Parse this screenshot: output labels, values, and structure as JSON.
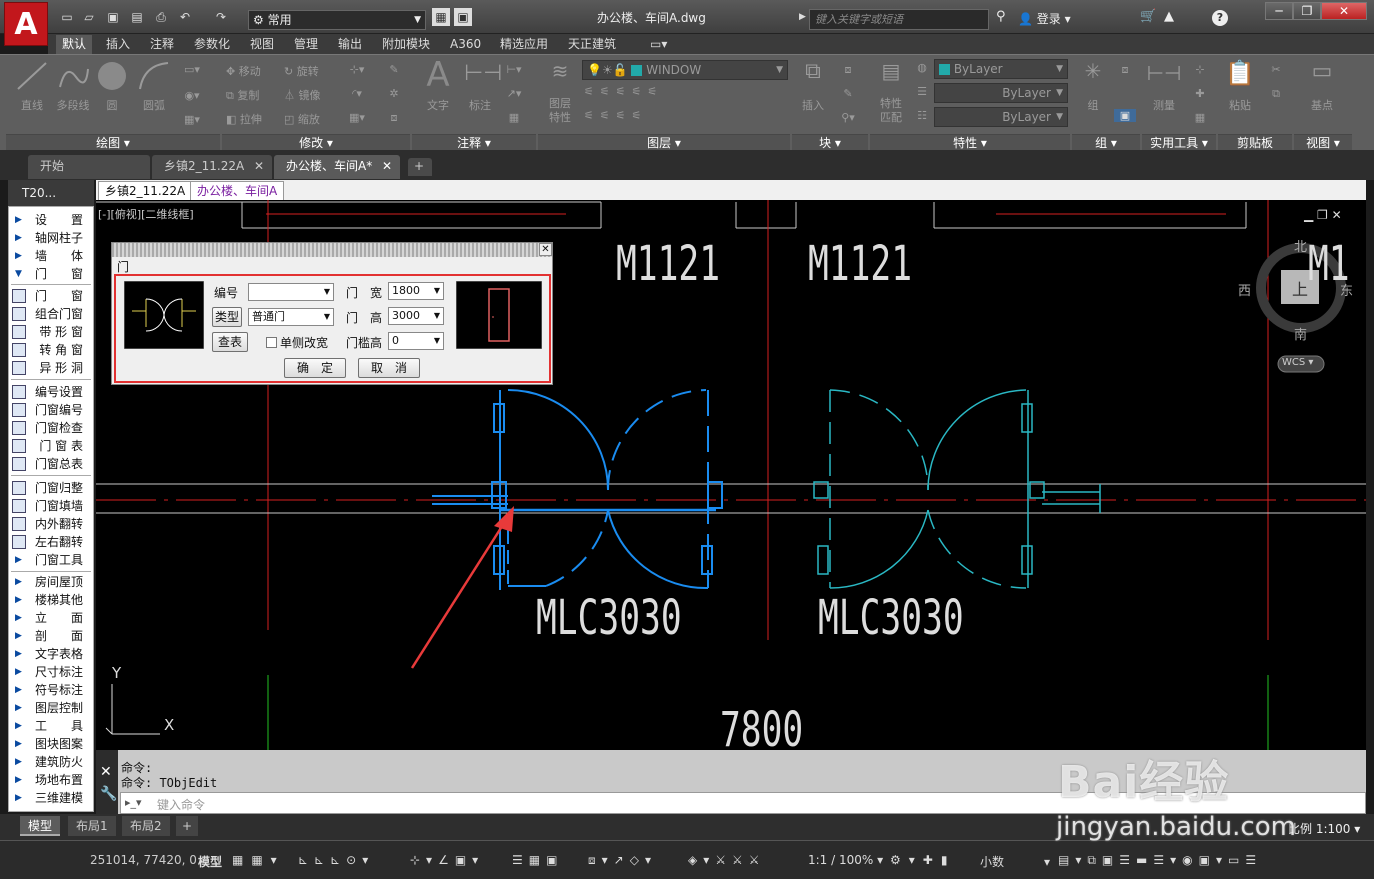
{
  "titlebar": {
    "app_logo": "A",
    "workspace": "常用",
    "doc_title": "办公楼、车间A.dwg",
    "search_placeholder": "键入关键字或短语",
    "login": "登录"
  },
  "ribbon_tabs": [
    "默认",
    "插入",
    "注释",
    "参数化",
    "视图",
    "管理",
    "输出",
    "附加模块",
    "A360",
    "精选应用",
    "天正建筑"
  ],
  "ribbon": {
    "tools": {
      "line": "直线",
      "polyline": "多段线",
      "circle": "圆",
      "arc": "圆弧",
      "move": "移动",
      "rotate": "旋转",
      "copy": "复制",
      "mirror": "镜像",
      "stretch": "拉伸",
      "scale": "缩放",
      "text": "文字",
      "dim": "标注",
      "layer_props": "图层\n特性",
      "layer_name": "WINDOW",
      "insert": "插入",
      "match": "特性\n匹配",
      "bylayer": "ByLayer",
      "group": "组",
      "measure": "测量",
      "paste": "粘贴",
      "base": "基点"
    },
    "panels": [
      "绘图",
      "修改",
      "注释",
      "图层",
      "块",
      "特性",
      "组",
      "实用工具",
      "剪贴板",
      "视图"
    ]
  },
  "file_tabs": [
    "开始",
    "乡镇2_11.22A",
    "办公楼、车间A*"
  ],
  "drawing_tabs": [
    "乡镇2_11.22A",
    "办公楼、车间A"
  ],
  "t20": {
    "title": "T20...",
    "items": [
      "设　　置",
      "轴网柱子",
      "墙　　体",
      "门　　窗",
      "门　　窗",
      "组合门窗",
      "带 形 窗",
      "转 角 窗",
      "异 形 洞",
      "编号设置",
      "门窗编号",
      "门窗检查",
      "门 窗 表",
      "门窗总表",
      "门窗归整",
      "门窗填墙",
      "内外翻转",
      "左右翻转",
      "门窗工具",
      "房间屋顶",
      "楼梯其他",
      "立　　面",
      "剖　　面",
      "文字表格",
      "尺寸标注",
      "符号标注",
      "图层控制",
      "工　　具",
      "图块图案",
      "建筑防火",
      "场地布置",
      "三维建模"
    ]
  },
  "viewport": {
    "label": "[-][俯视][二维线框]",
    "labels": [
      "M1121",
      "M1121",
      "M1",
      "MLC3030",
      "MLC3030",
      "7800"
    ],
    "compass": {
      "north": "北",
      "south": "南",
      "east": "东",
      "west": "西",
      "top": "上",
      "wcs": "WCS"
    },
    "ucs": {
      "x": "X",
      "y": "Y"
    }
  },
  "dialog": {
    "title": "门",
    "number_label": "编号",
    "number_value": "",
    "type_button": "类型",
    "type_value": "普通门",
    "lookup_button": "查表",
    "single_side_label": "单侧改宽",
    "width_label": "门　宽",
    "width_value": "1800",
    "height_label": "门　高",
    "height_value": "3000",
    "sill_label": "门槛高",
    "sill_value": "0",
    "ok_button": "确　定",
    "cancel_button": "取　消"
  },
  "command": {
    "line1": "命令:",
    "line2": "命令: TObjEdit",
    "placeholder": "键入命令"
  },
  "layout_tabs": [
    "模型",
    "布局1",
    "布局2"
  ],
  "status": {
    "coords": "251014, 77420, 0",
    "model": "模型",
    "scale": "1:1 / 100%",
    "units": "小数",
    "ratio": "比例 1:100"
  },
  "watermark": {
    "brand": "Bai经验",
    "url": "jingyan.baidu.com"
  }
}
